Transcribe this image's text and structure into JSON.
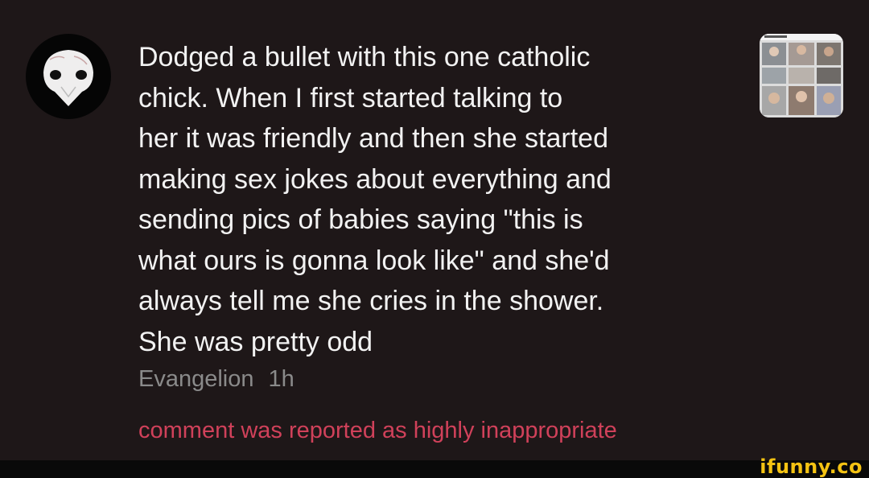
{
  "comment": {
    "avatar_icon": "masked-face-avatar-icon",
    "text": "Dodged a bullet with this one catholic\nchick. When I first started talking to\nher it was friendly and then she started\nmaking sex jokes about everything and\nsending pics of babies saying \"this is\nwhat ours is gonna look like\" and she'd\nalways tell me she cries in the shower.\nShe was pretty odd",
    "author": "Evangelion",
    "time": "1h",
    "report_notice": "comment was reported as highly inappropriate"
  },
  "post_thumbnail": {
    "icon": "post-collage-thumbnail"
  },
  "watermark": {
    "text": "ifunny.co",
    "color": "#f4c313"
  },
  "colors": {
    "background": "#1e1718",
    "text": "#f2f2f2",
    "meta": "#8a8a8a",
    "report": "#d0415a"
  }
}
